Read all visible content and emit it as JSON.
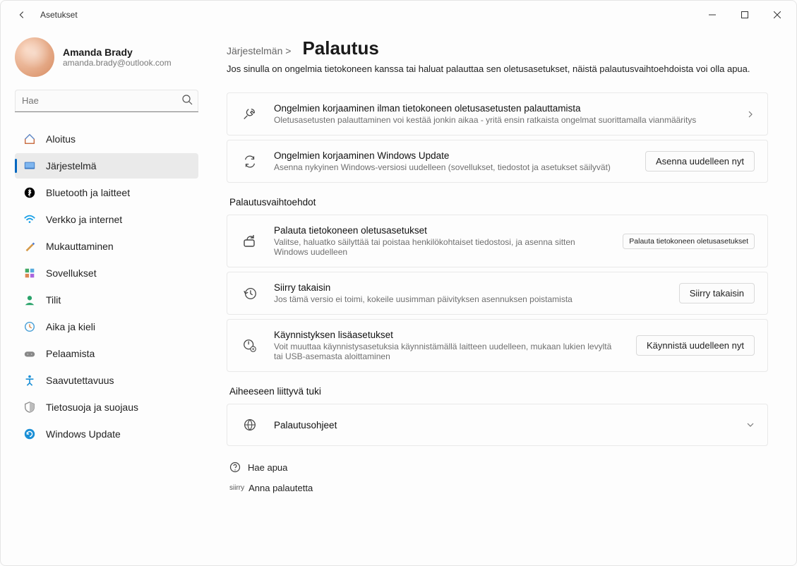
{
  "window": {
    "title": "Asetukset"
  },
  "profile": {
    "name": "Amanda Brady",
    "email": "amanda.brady@outlook.com"
  },
  "search": {
    "placeholder": "Hae"
  },
  "nav": {
    "items": [
      {
        "label": "Aloitus"
      },
      {
        "label": "Järjestelmä"
      },
      {
        "label": "Bluetooth ja laitteet"
      },
      {
        "label": "Verkko ja internet"
      },
      {
        "label": "Mukauttaminen"
      },
      {
        "label": "Sovellukset"
      },
      {
        "label": "Tilit"
      },
      {
        "label": "Aika ja kieli"
      },
      {
        "label": "Pelaamista"
      },
      {
        "label": "Saavutettavuus"
      },
      {
        "label": "Tietosuoja ja suojaus"
      },
      {
        "label": "Windows Update"
      }
    ]
  },
  "main": {
    "breadcrumb_parent": "Järjestelmän   >  ",
    "breadcrumb_title": "Palautus",
    "intro": "Jos sinulla on ongelmia tietokoneen kanssa tai haluat palauttaa sen oletusasetukset, näistä palautusvaihtoehdoista voi olla apua.",
    "cards_top": [
      {
        "title": "Ongelmien korjaaminen ilman tietokoneen oletusasetusten palauttamista",
        "desc": "Oletusasetusten palauttaminen voi kestää jonkin aikaa - yritä ensin ratkaista ongelmat suorittamalla vianmääritys",
        "action_type": "chevron"
      },
      {
        "title": "Ongelmien korjaaminen Windows Update",
        "desc": "Asenna nykyinen Windows-versiosi uudelleen (sovellukset, tiedostot ja asetukset säilyvät)",
        "action_type": "button",
        "action_label": "Asenna uudelleen nyt"
      }
    ],
    "section_recovery_title": "Palautusvaihtoehdot",
    "cards_recovery": [
      {
        "title": "Palauta tietokoneen oletusasetukset",
        "desc": "Valitse, haluatko säilyttää tai poistaa henkilökohtaiset tiedostosi, ja asenna sitten Windows uudelleen",
        "action_label": "Palauta tietokoneen oletusasetukset",
        "small": true
      },
      {
        "title": "Siirry takaisin",
        "desc": "Jos tämä versio ei toimi, kokeile uusimman päivityksen asennuksen poistamista",
        "action_label": "Siirry takaisin"
      },
      {
        "title": "Käynnistyksen lisäasetukset",
        "desc": "Voit muuttaa käynnistysasetuksia käynnistämällä laitteen uudelleen, mukaan lukien levyltä tai USB-asemasta aloittaminen",
        "action_label": "Käynnistä uudelleen nyt"
      }
    ],
    "section_support_title": "Aiheeseen liittyvä tuki",
    "support_card": {
      "title": "Palautusohjeet"
    },
    "help_links": {
      "get_help": "Hae apua",
      "feedback_prefix": "siirry",
      "feedback": "Anna palautetta"
    }
  }
}
